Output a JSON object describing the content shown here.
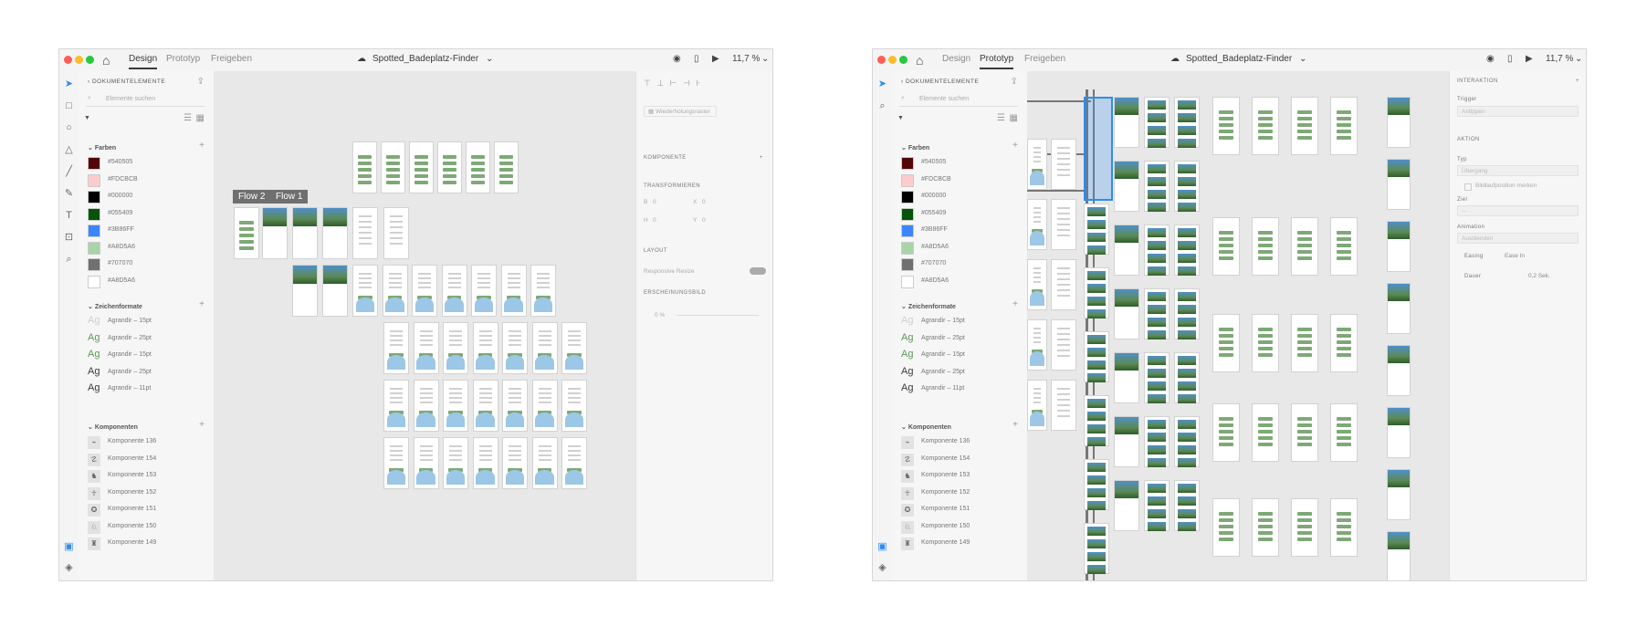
{
  "left": {
    "tabs": [
      "Design",
      "Prototyp",
      "Freigeben"
    ],
    "active_tab": "Design",
    "doc_name": "Spotted_Badeplatz-Finder",
    "zoom": "11,7 %",
    "panel_title": "DOKUMENTELEMENTE",
    "search_placeholder": "Elemente suchen",
    "flow_tags": [
      "Flow 2",
      "Flow 1"
    ],
    "inspector": {
      "repeat": "Wiederholungsraster",
      "komponente": "KOMPONENTE",
      "transform": "TRANSFORMIEREN",
      "b": "B",
      "x": "X",
      "h": "H",
      "y": "Y",
      "zero": "0",
      "layout": "LAYOUT",
      "resize": "Responsive Resize",
      "appearance": "ERSCHEINUNGSBILD",
      "opacity": "0 %"
    }
  },
  "right": {
    "tabs": [
      "Design",
      "Prototyp",
      "Freigeben"
    ],
    "active_tab": "Prototyp",
    "doc_name": "Spotted_Badeplatz-Finder",
    "zoom": "11,7 %",
    "panel_title": "DOKUMENTELEMENTE",
    "search_placeholder": "Elemente suchen",
    "inspector": {
      "interaction": "INTERAKTION",
      "trigger_label": "Trigger",
      "trigger": "Antippen",
      "aktion": "AKTION",
      "typ_label": "Typ",
      "typ": "Übergang",
      "remember": "Bildlaufposition merken",
      "ziel_label": "Ziel",
      "ziel": "--",
      "animation_label": "Animation",
      "animation": "Ausblenden",
      "easing_label": "Easing",
      "easing": "Ease In",
      "dauer_label": "Dauer",
      "dauer": "0,2 Sek."
    }
  },
  "sections": {
    "farben": "Farben",
    "zeichenformate": "Zeichenformate",
    "komponenten": "Komponenten"
  },
  "colors": [
    {
      "hex": "#540505",
      "label": "#540505"
    },
    {
      "hex": "#FDCBCB",
      "label": "#FDCBCB"
    },
    {
      "hex": "#000000",
      "label": "#000000"
    },
    {
      "hex": "#055409",
      "label": "#055409"
    },
    {
      "hex": "#3B86FF",
      "label": "#3B86FF"
    },
    {
      "hex": "#A8D5A6",
      "label": "#A8D5A6"
    },
    {
      "hex": "#707070",
      "label": "#707070"
    },
    {
      "hex": "#FFFFFF",
      "label": "#A8D5A6"
    }
  ],
  "char_styles": [
    {
      "label": "Agrandir – 15pt",
      "color": "#cfcfcf"
    },
    {
      "label": "Agrandir – 25pt",
      "color": "#5b9b55"
    },
    {
      "label": "Agrandir – 15pt",
      "color": "#5b9b55"
    },
    {
      "label": "Agrandir – 25pt",
      "color": "#3a3a3a"
    },
    {
      "label": "Agrandir – 11pt",
      "color": "#3a3a3a"
    }
  ],
  "char_glyph": "Ag",
  "components": [
    "Komponente 136",
    "Komponente 154",
    "Komponente 153",
    "Komponente 152",
    "Komponente 151",
    "Komponente 150",
    "Komponente 149"
  ]
}
